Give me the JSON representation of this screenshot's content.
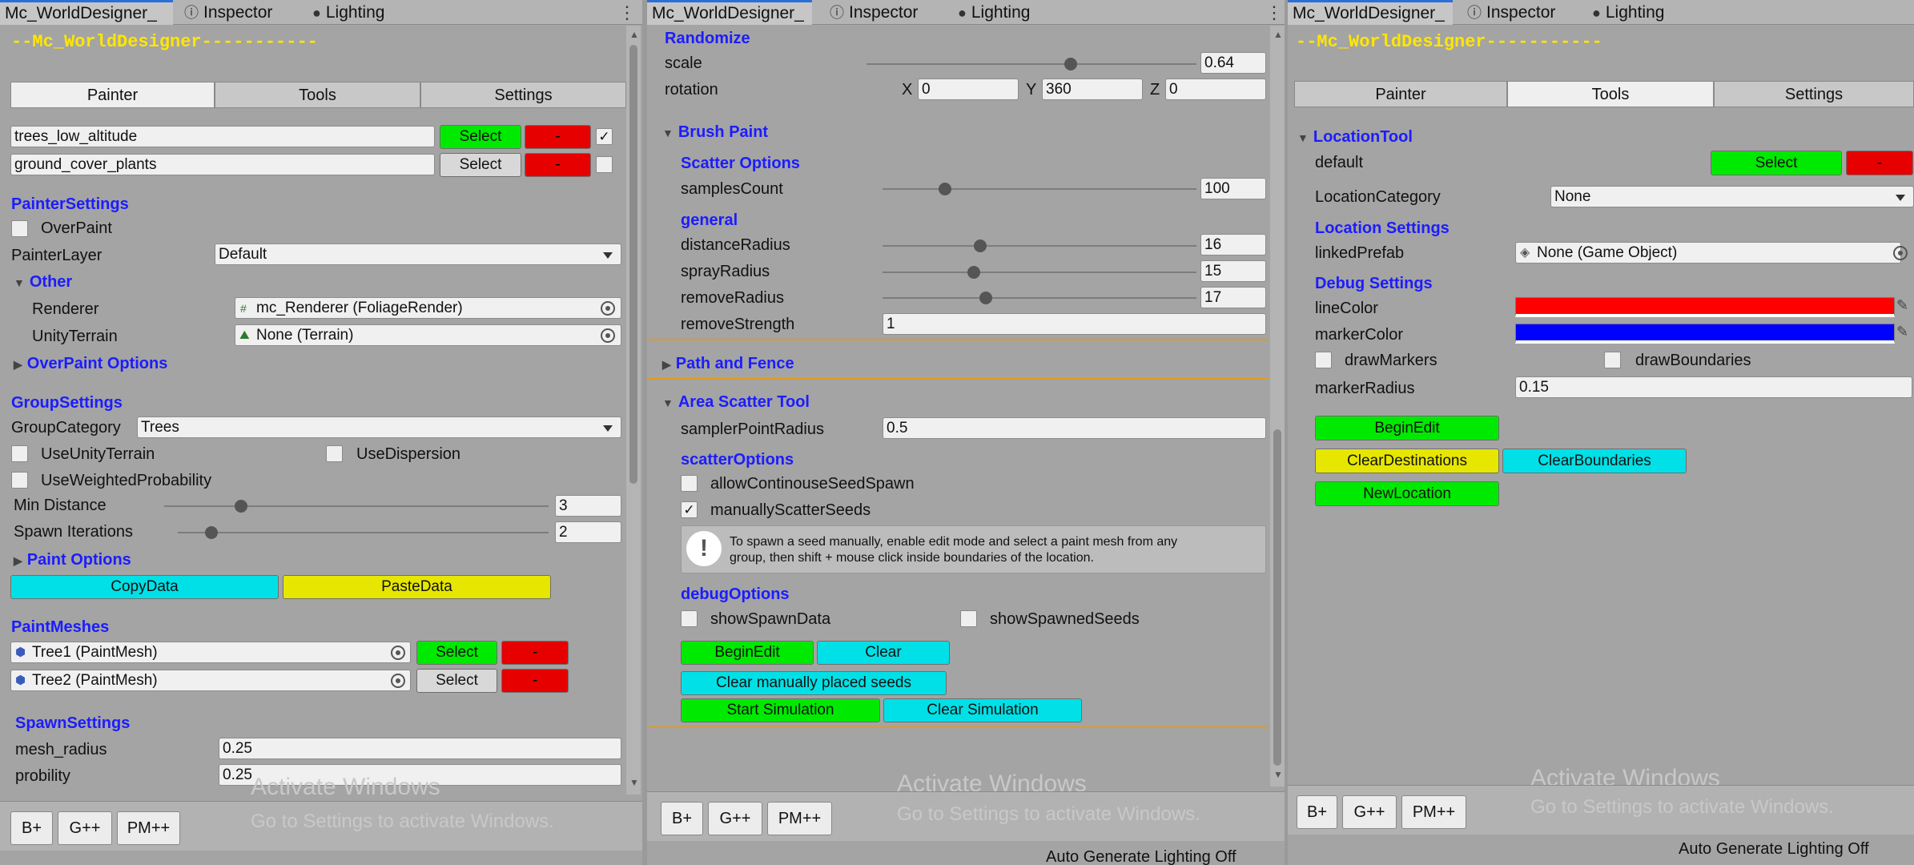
{
  "tabs": {
    "designer": "Mc_WorldDesigner_",
    "inspector": "Inspector",
    "lighting": "Lighting"
  },
  "icons": {
    "inspector": "info-icon",
    "lighting": "lightbulb-icon",
    "menu": "kebab-menu-icon"
  },
  "colors": {
    "section_blue": "#1c1cff",
    "title_yellow": "#ffe600",
    "green": "#00e900",
    "red": "#e60000",
    "cyan": "#00e0e6",
    "yellow": "#e6e600",
    "line_color": "#ff0000",
    "marker_color": "#0000ff"
  },
  "watermark": {
    "line1": "Activate Windows",
    "line2": "Go to Settings to activate Windows."
  },
  "shortcuts": {
    "b": "B+",
    "g": "G++",
    "pm": "PM++"
  },
  "status_text": "Auto Generate Lighting Off",
  "left": {
    "title": "--Mc_WorldDesigner-----------",
    "toolbar": [
      "Painter",
      "Tools",
      "Settings"
    ],
    "layers": [
      {
        "name": "trees_low_altitude",
        "select": "Select",
        "remove": "-",
        "checked": true
      },
      {
        "name": "ground_cover_plants",
        "select": "Select",
        "remove": "-",
        "checked": false
      }
    ],
    "painter_settings": "PainterSettings",
    "overpaint": "OverPaint",
    "painter_layer_label": "PainterLayer",
    "painter_layer_value": "Default",
    "other": "Other",
    "renderer_label": "Renderer",
    "renderer_value": "mc_Renderer (FoliageRender)",
    "unity_terrain_label": "UnityTerrain",
    "unity_terrain_value": "None (Terrain)",
    "overpaint_options": "OverPaint Options",
    "group_settings": "GroupSettings",
    "group_category_label": "GroupCategory",
    "group_category_value": "Trees",
    "use_unity_terrain": "UseUnityTerrain",
    "use_dispersion": "UseDispersion",
    "use_weighted": "UseWeightedProbability",
    "min_distance_label": "Min Distance",
    "min_distance_value": "3",
    "min_distance_fraction": 0.2,
    "spawn_iterations_label": "Spawn Iterations",
    "spawn_iterations_value": "2",
    "spawn_iterations_fraction": 0.09,
    "paint_options": "Paint Options",
    "copy_data": "CopyData",
    "paste_data": "PasteData",
    "paint_meshes": "PaintMeshes",
    "meshes": [
      {
        "name": "Tree1 (PaintMesh)",
        "select": "Select",
        "remove": "-"
      },
      {
        "name": "Tree2 (PaintMesh)",
        "select": "Select",
        "remove": "-"
      }
    ],
    "spawn_settings": "SpawnSettings",
    "mesh_radius_label": "mesh_radius",
    "mesh_radius_value": "0.25",
    "probility_label": "probility",
    "probility_value": "0.25"
  },
  "middle": {
    "randomize": "Randomize",
    "scale_label": "scale",
    "scale_value": "0.64",
    "scale_fraction": 0.62,
    "rotation_label": "rotation",
    "x_label": "X",
    "x_value": "0",
    "y_label": "Y",
    "y_value": "360",
    "z_label": "Z",
    "z_value": "0",
    "brush_paint": "Brush Paint",
    "scatter_options": "Scatter Options",
    "samples_count_label": "samplesCount",
    "samples_count_value": "100",
    "samples_fraction": 0.2,
    "general": "general",
    "distance_radius_label": "distanceRadius",
    "distance_radius_value": "16",
    "distance_fraction": 0.31,
    "spray_radius_label": "sprayRadius",
    "spray_radius_value": "15",
    "spray_fraction": 0.29,
    "remove_radius_label": "removeRadius",
    "remove_radius_value": "17",
    "remove_fraction": 0.33,
    "remove_strength_label": "removeStrength",
    "remove_strength_value": "1",
    "path_and_fence": "Path and Fence",
    "area_scatter": "Area Scatter Tool",
    "sampler_point_radius_label": "samplerPointRadius",
    "sampler_point_radius_value": "0.5",
    "scatter_options2": "scatterOptions",
    "allow_continuous": "allowContinouseSeedSpawn",
    "manually_scatter": "manuallyScatterSeeds",
    "help_line1": "To spawn a seed manually, enable edit mode and select a paint mesh from any",
    "help_line2": "group, then shift + mouse click inside boundaries of the location.",
    "debug_options": "debugOptions",
    "show_spawn_data": "showSpawnData",
    "show_spawned_seeds": "showSpawnedSeeds",
    "begin_edit": "BeginEdit",
    "clear": "Clear",
    "clear_manual": "Clear manually placed seeds",
    "start_sim": "Start Simulation",
    "clear_sim": "Clear Simulation"
  },
  "right": {
    "title": "--Mc_WorldDesigner-----------",
    "toolbar": [
      "Painter",
      "Tools",
      "Settings"
    ],
    "location_tool": "LocationTool",
    "default_label": "default",
    "select": "Select",
    "remove": "-",
    "location_category_label": "LocationCategory",
    "location_category_value": "None",
    "location_settings": "Location Settings",
    "linked_prefab_label": "linkedPrefab",
    "linked_prefab_value": "None (Game Object)",
    "debug_settings": "Debug Settings",
    "line_color_label": "lineColor",
    "marker_color_label": "markerColor",
    "draw_markers": "drawMarkers",
    "draw_boundaries": "drawBoundaries",
    "marker_radius_label": "markerRadius",
    "marker_radius_value": "0.15",
    "begin_edit": "BeginEdit",
    "clear_destinations": "ClearDestinations",
    "clear_boundaries": "ClearBoundaries",
    "new_location": "NewLocation"
  }
}
